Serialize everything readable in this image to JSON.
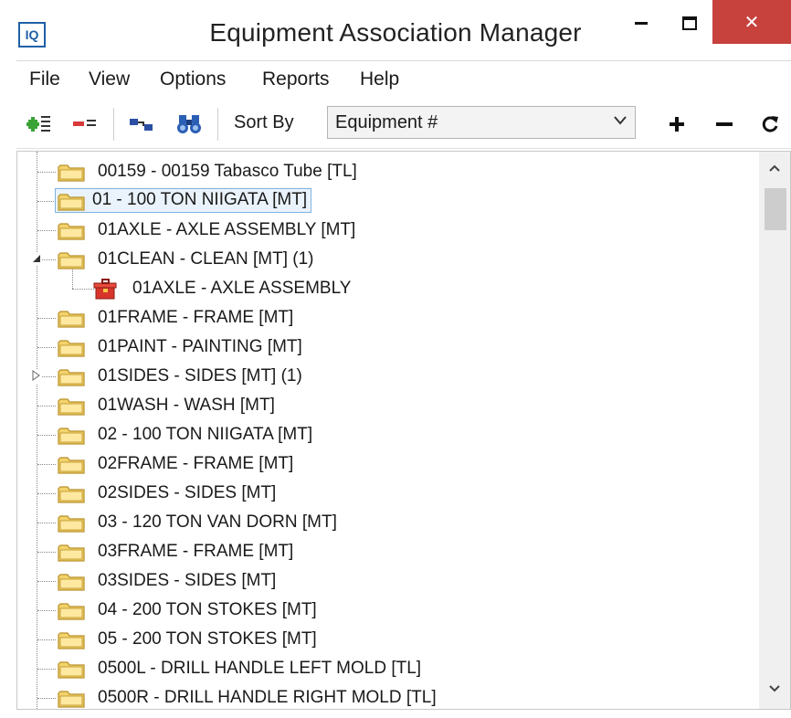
{
  "window": {
    "title": "Equipment Association Manager",
    "app_icon_text": "IQ",
    "close_glyph": "✕"
  },
  "menu": [
    "File",
    "View",
    "Options",
    "Reports",
    "Help"
  ],
  "toolbar": {
    "sort_label": "Sort By",
    "sort_value": "Equipment #",
    "icons": [
      "add-association-icon",
      "remove-association-icon",
      "link-icon",
      "find-binoculars-icon",
      "expand-plus-icon",
      "collapse-minus-icon",
      "refresh-icon"
    ]
  },
  "tree": {
    "items": [
      {
        "label": "00159 - 00159 Tabasco Tube  [TL]",
        "level": 0,
        "icon": "folder-icon",
        "expander": ""
      },
      {
        "label": "01 - 100 TON NIIGATA [MT]",
        "level": 0,
        "icon": "folder-icon",
        "expander": "",
        "selected": true
      },
      {
        "label": "01AXLE - AXLE ASSEMBLY [MT]",
        "level": 0,
        "icon": "folder-icon",
        "expander": ""
      },
      {
        "label": "01CLEAN - CLEAN [MT] (1)",
        "level": 0,
        "icon": "folder-icon",
        "expander": "expanded"
      },
      {
        "label": "01AXLE - AXLE ASSEMBLY",
        "level": 1,
        "icon": "toolbox-icon",
        "expander": ""
      },
      {
        "label": "01FRAME - FRAME [MT]",
        "level": 0,
        "icon": "folder-icon",
        "expander": ""
      },
      {
        "label": "01PAINT - PAINTING [MT]",
        "level": 0,
        "icon": "folder-icon",
        "expander": ""
      },
      {
        "label": "01SIDES - SIDES [MT] (1)",
        "level": 0,
        "icon": "folder-icon",
        "expander": "collapsed"
      },
      {
        "label": "01WASH - WASH [MT]",
        "level": 0,
        "icon": "folder-icon",
        "expander": ""
      },
      {
        "label": "02 - 100 TON NIIGATA [MT]",
        "level": 0,
        "icon": "folder-icon",
        "expander": ""
      },
      {
        "label": "02FRAME - FRAME [MT]",
        "level": 0,
        "icon": "folder-icon",
        "expander": ""
      },
      {
        "label": "02SIDES - SIDES [MT]",
        "level": 0,
        "icon": "folder-icon",
        "expander": ""
      },
      {
        "label": "03 - 120 TON VAN DORN [MT]",
        "level": 0,
        "icon": "folder-icon",
        "expander": ""
      },
      {
        "label": "03FRAME - FRAME [MT]",
        "level": 0,
        "icon": "folder-icon",
        "expander": ""
      },
      {
        "label": "03SIDES - SIDES [MT]",
        "level": 0,
        "icon": "folder-icon",
        "expander": ""
      },
      {
        "label": "04 - 200 TON STOKES [MT]",
        "level": 0,
        "icon": "folder-icon",
        "expander": ""
      },
      {
        "label": "05 - 200 TON STOKES [MT]",
        "level": 0,
        "icon": "folder-icon",
        "expander": ""
      },
      {
        "label": "0500L - DRILL HANDLE LEFT MOLD [TL]",
        "level": 0,
        "icon": "folder-icon",
        "expander": ""
      },
      {
        "label": "0500R - DRILL HANDLE RIGHT MOLD [TL]",
        "level": 0,
        "icon": "folder-icon",
        "expander": ""
      }
    ]
  },
  "colors": {
    "close_button": "#c7413d",
    "selection_border": "#7fb2e0",
    "folder_fill": "#f3d36b",
    "folder_stroke": "#b8902a",
    "app_icon_blue": "#1f5fa8"
  }
}
